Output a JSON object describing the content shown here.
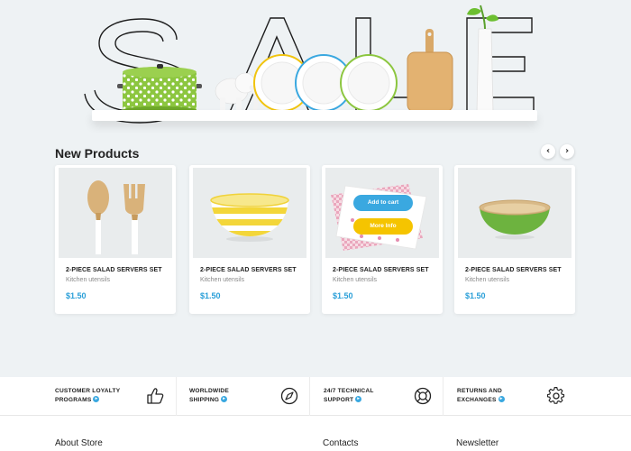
{
  "hero": {
    "banner_text": "SALE"
  },
  "products_section": {
    "title": "New Products",
    "prev_icon": "chevron-left-icon",
    "next_icon": "chevron-right-icon"
  },
  "products": [
    {
      "name": "2-PIECE SALAD SERVERS SET",
      "category": "Kitchen utensils",
      "price": "$1.50",
      "image": "wooden-salad-servers"
    },
    {
      "name": "2-PIECE SALAD SERVERS SET",
      "category": "Kitchen utensils",
      "price": "$1.50",
      "image": "striped-yellow-bowl"
    },
    {
      "name": "2-PIECE SALAD SERVERS SET",
      "category": "Kitchen utensils",
      "price": "$1.50",
      "image": "pink-napkins",
      "add_to_cart_label": "Add to cart",
      "more_info_label": "More Info"
    },
    {
      "name": "2-PIECE SALAD SERVERS SET",
      "category": "Kitchen utensils",
      "price": "$1.50",
      "image": "green-wooden-bowl"
    }
  ],
  "features": [
    {
      "line1": "CUSTOMER LOYALTY",
      "line2": "PROGRAMS",
      "icon": "thumbs-up-icon"
    },
    {
      "line1": "WORLDWIDE",
      "line2": "SHIPPING",
      "icon": "compass-icon"
    },
    {
      "line1": "24/7 TECHNICAL",
      "line2": "SUPPORT",
      "icon": "lifebuoy-icon"
    },
    {
      "line1": "RETURNS AND",
      "line2": "EXCHANGES",
      "icon": "gear-icon"
    }
  ],
  "footer": {
    "about_title": "About Store",
    "contacts_title": "Contacts",
    "newsletter_title": "Newsletter"
  },
  "colors": {
    "accent": "#3aa8e0",
    "price": "#2a9fd8",
    "more_info": "#f5c400",
    "background": "#eef2f4"
  }
}
